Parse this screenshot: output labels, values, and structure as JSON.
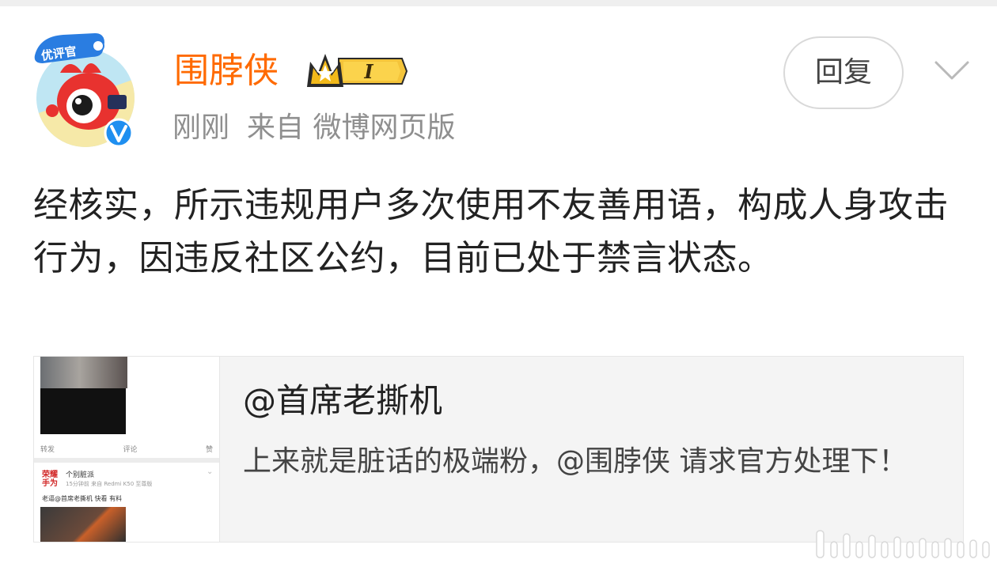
{
  "post": {
    "avatar_badge": "优评官",
    "username": "围脖侠",
    "level_badge": "I",
    "time": "刚刚",
    "source": "来自 微博网页版",
    "reply_label": "回复",
    "content": "经核实，所示违规用户多次使用不友善用语，构成人身攻击行为，因违反社区公约，目前已处于禁言状态。"
  },
  "quote": {
    "mention": "@首席老撕机",
    "text": "上来就是脏话的极端粉，@围脖侠 请求官方处理下！"
  },
  "thumbnail": {
    "actions": [
      "转发",
      "评论",
      "赞"
    ],
    "account_logo": "荣耀手为",
    "account_name": "个别脏派",
    "account_meta": "15分钟前  来自 Redmi K50 至尊版",
    "post_text": "老逼@首席老撕机 快看 有料"
  },
  "colors": {
    "username": "#ff6a00",
    "meta": "#8f8f8f",
    "verified": "#1f8ff0",
    "crown": "#f2b91a"
  },
  "icons": {
    "verified": "verified-v-icon",
    "expand": "chevron-down-icon",
    "level": "crown-badge-icon"
  }
}
